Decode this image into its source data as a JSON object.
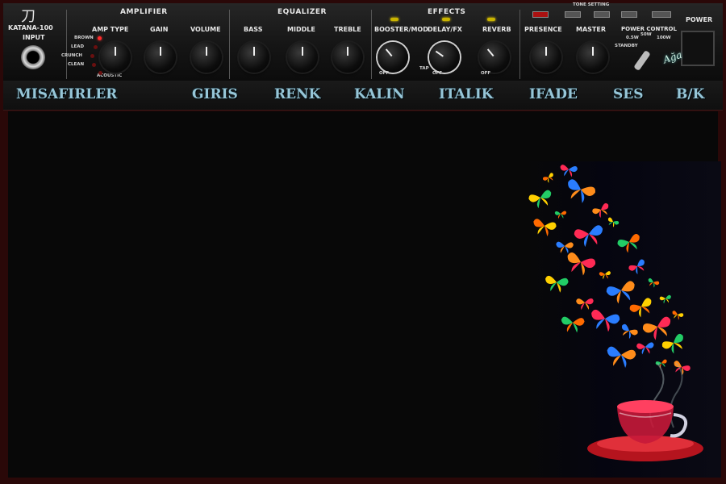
{
  "amp": {
    "brand": "KATANA-100",
    "brand_glyph": "刀",
    "input_label": "INPUT",
    "sections": {
      "amplifier": "AMPLIFIER",
      "equalizer": "EQUALIZER",
      "effects": "EFFECTS",
      "tone_setting": "TONE SETTING",
      "power": "POWER"
    },
    "knob_labels": {
      "amp_type": "AMP TYPE",
      "gain": "GAIN",
      "volume": "VOLUME",
      "bass": "BASS",
      "middle": "MIDDLE",
      "treble": "TREBLE",
      "booster": "BOOSTER/MOD",
      "delay": "DELAY/FX",
      "reverb": "REVERB",
      "presence": "PRESENCE",
      "master": "MASTER",
      "power_control": "POWER CONTROL"
    },
    "amp_types": [
      "BROWN",
      "LEAD",
      "CRUNCH",
      "CLEAN",
      "ACOUSTIC"
    ],
    "tone_buttons": [
      "CH1",
      "CH2",
      "CH3",
      "CH4",
      "PANEL"
    ],
    "power_options": [
      "0.5W",
      "50W",
      "100W",
      "STANDBY"
    ],
    "off_label": "OFF",
    "tap_label": "TAP",
    "signature": "Ağa"
  },
  "menu": {
    "items": [
      "MISAFIRLER",
      "GIRIS",
      "RENK",
      "KALIN",
      "ITALIK",
      "IFADE",
      "SES",
      "B/K"
    ]
  },
  "decoration": {
    "description_icon": "butterflies-tea-cup-icon"
  }
}
